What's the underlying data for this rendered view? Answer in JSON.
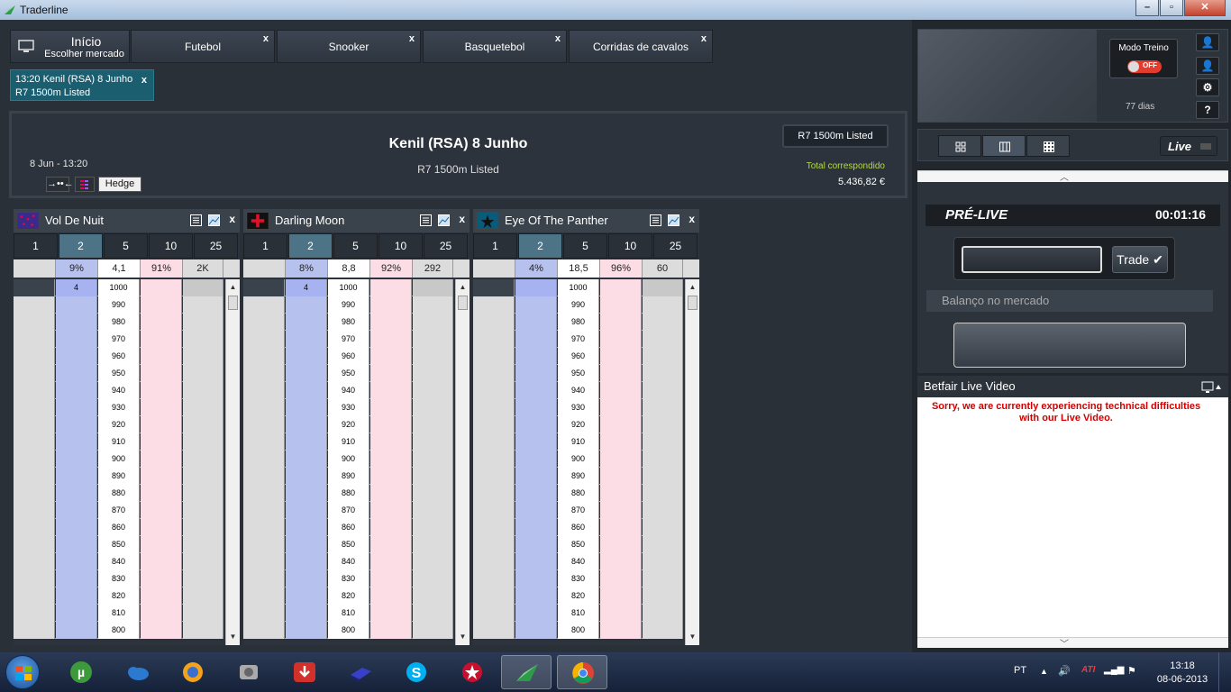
{
  "window": {
    "title": "Traderline"
  },
  "tabs": {
    "home": {
      "title": "Início",
      "subtitle": "Escolher mercado"
    },
    "items": [
      {
        "label": "Futebol"
      },
      {
        "label": "Snooker"
      },
      {
        "label": "Basquetebol"
      },
      {
        "label": "Corridas de cavalos"
      }
    ],
    "close": "x"
  },
  "subtab": {
    "line1": "13:20 Kenil (RSA) 8 Junho",
    "line2": "R7 1500m Listed",
    "close": "x"
  },
  "market": {
    "title": "Kenil (RSA) 8 Junho",
    "subtitle": "R7 1500m Listed",
    "date": "8 Jun - 13:20",
    "hedge": "Hedge",
    "race_button": "R7 1500m Listed",
    "total_label": "Total correspondido",
    "total_value": "5.436,82 €"
  },
  "stakes": [
    "1",
    "2",
    "5",
    "10",
    "25"
  ],
  "runners": [
    {
      "name": "Vol De Nuit",
      "summary": [
        "",
        "9%",
        "4,1",
        "91%",
        "2K"
      ],
      "first_back": "4"
    },
    {
      "name": "Darling Moon",
      "summary": [
        "",
        "8%",
        "8,8",
        "92%",
        "292"
      ],
      "first_back": "4"
    },
    {
      "name": "Eye Of The Panther",
      "summary": [
        "",
        "4%",
        "18,5",
        "96%",
        "60"
      ],
      "first_back": ""
    }
  ],
  "ladder_prices": [
    "1000",
    "990",
    "980",
    "970",
    "960",
    "950",
    "940",
    "930",
    "920",
    "910",
    "900",
    "890",
    "880",
    "870",
    "860",
    "850",
    "840",
    "830",
    "820",
    "810",
    "800"
  ],
  "side": {
    "modo_treino": "Modo Treino",
    "toggle": "OFF",
    "dias": "77 dias",
    "help": "?",
    "live": "Live",
    "pre_live": "PRÉ-LIVE",
    "timer": "00:01:16",
    "trade": "Trade ✔",
    "balanco": "Balanço no mercado",
    "video_title": "Betfair Live Video",
    "video_error": "Sorry, we are currently experiencing technical difficulties with our Live Video."
  },
  "taskbar": {
    "lang": "PT",
    "time": "13:18",
    "date": "08-06-2013"
  },
  "colors": {
    "back": "#b7c1ed",
    "lay": "#fcdde6",
    "selected_stake": "#4d7387",
    "total_label": "#b4d94a",
    "video_error": "#d20000"
  }
}
